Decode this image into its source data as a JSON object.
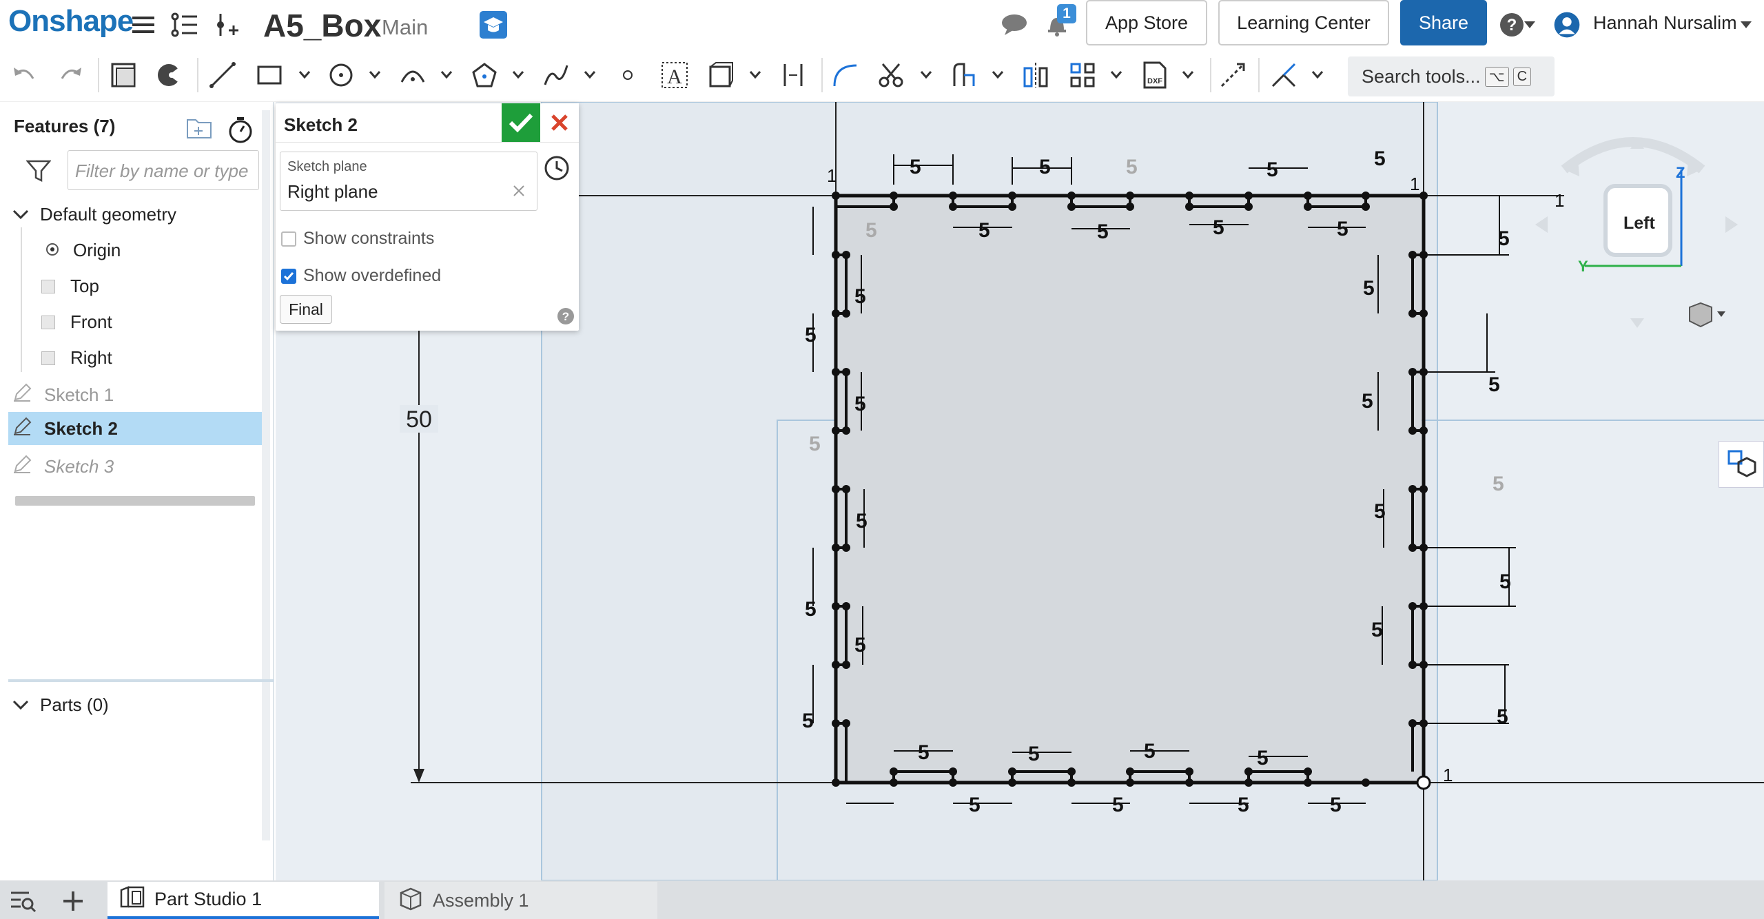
{
  "header": {
    "logo": "Onshape",
    "doc_name": "A5_Box",
    "branch": "Main",
    "notification_count": "1",
    "app_store": "App Store",
    "learning_center": "Learning Center",
    "share": "Share",
    "user_name": "Hannah Nursalim"
  },
  "toolbar": {
    "search_label": "Search tools...",
    "search_key1": "⌥",
    "search_key2": "C"
  },
  "features": {
    "title": "Features (7)",
    "filter_placeholder": "Filter by name or type",
    "default_geometry": "Default geometry",
    "origin": "Origin",
    "planes": [
      "Top",
      "Front",
      "Right"
    ],
    "sketches": [
      "Sketch 1",
      "Sketch 2",
      "Sketch 3"
    ],
    "parts": "Parts (0)"
  },
  "sketch_dialog": {
    "title": "Sketch 2",
    "plane_label": "Sketch plane",
    "plane_value": "Right plane",
    "show_constraints": "Show constraints",
    "show_constraints_checked": false,
    "show_overdefined": "Show overdefined",
    "show_overdefined_checked": true,
    "final": "Final"
  },
  "viewcube": {
    "face": "Left",
    "axis_z": "Z",
    "axis_y": "Y"
  },
  "sketch": {
    "height_dim": "50",
    "dim_label": "5",
    "corner_label": "1"
  },
  "tabs": {
    "part_studio": "Part Studio 1",
    "assembly": "Assembly 1"
  },
  "colors": {
    "brand": "#1c72b8",
    "share": "#1c67ad",
    "ok": "#1e9e3a",
    "cancel": "#d9442c",
    "selected": "#b3dbf5",
    "viewport": "#e9eef3"
  }
}
